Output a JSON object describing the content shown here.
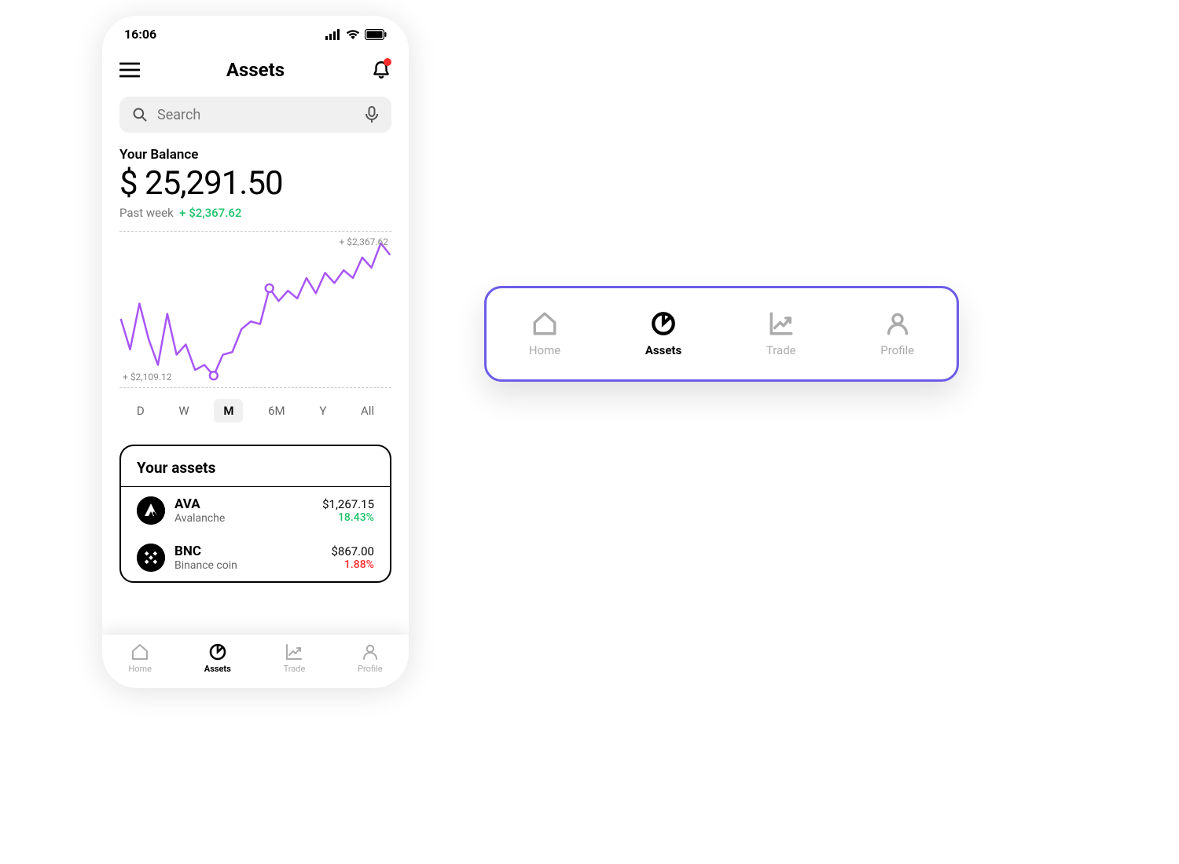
{
  "status": {
    "time": "16:06"
  },
  "header": {
    "title": "Assets"
  },
  "search": {
    "placeholder": "Search"
  },
  "balance": {
    "label": "Your Balance",
    "amount": "$ 25,291.50",
    "period": "Past week",
    "delta": "+ $2,367.62"
  },
  "chart": {
    "top_label": "+ $2,367.62",
    "bottom_label": "+ $2,109.12",
    "ranges": [
      "D",
      "W",
      "M",
      "6M",
      "Y",
      "All"
    ],
    "active_range": "M",
    "color": "#a855f7"
  },
  "chart_data": {
    "type": "line",
    "title": "",
    "xlabel": "",
    "ylabel": "",
    "ylim": [
      2109.12,
      2367.62
    ],
    "x": [
      0,
      1,
      2,
      3,
      4,
      5,
      6,
      7,
      8,
      9,
      10,
      11,
      12,
      13,
      14,
      15,
      16,
      17,
      18,
      19,
      20,
      21,
      22,
      23,
      24,
      25,
      26,
      27,
      28,
      29
    ],
    "values": [
      2220,
      2160,
      2250,
      2180,
      2130,
      2230,
      2150,
      2170,
      2120,
      2130,
      2109,
      2150,
      2155,
      2200,
      2215,
      2210,
      2280,
      2255,
      2275,
      2260,
      2300,
      2270,
      2310,
      2290,
      2315,
      2300,
      2340,
      2320,
      2368,
      2345
    ],
    "markers": [
      {
        "x": 10,
        "value": 2109
      },
      {
        "x": 16,
        "value": 2280
      }
    ],
    "annotations": {
      "top_right": "+ $2,367.62",
      "bottom_left": "+ $2,109.12"
    }
  },
  "assets": {
    "title": "Your assets",
    "items": [
      {
        "symbol": "AVA",
        "name": "Avalanche",
        "price": "$1,267.15",
        "change": "18.43%",
        "direction": "positive"
      },
      {
        "symbol": "BNC",
        "name": "Binance coin",
        "price": "$867.00",
        "change": "1.88%",
        "direction": "negative"
      }
    ]
  },
  "tabbar": {
    "items": [
      {
        "label": "Home",
        "icon": "home"
      },
      {
        "label": "Assets",
        "icon": "pie"
      },
      {
        "label": "Trade",
        "icon": "chart-up"
      },
      {
        "label": "Profile",
        "icon": "person"
      }
    ],
    "active": "Assets"
  },
  "colors": {
    "accent": "#6c5ce7",
    "positive": "#1ec26a",
    "negative": "#ff2d2d"
  }
}
